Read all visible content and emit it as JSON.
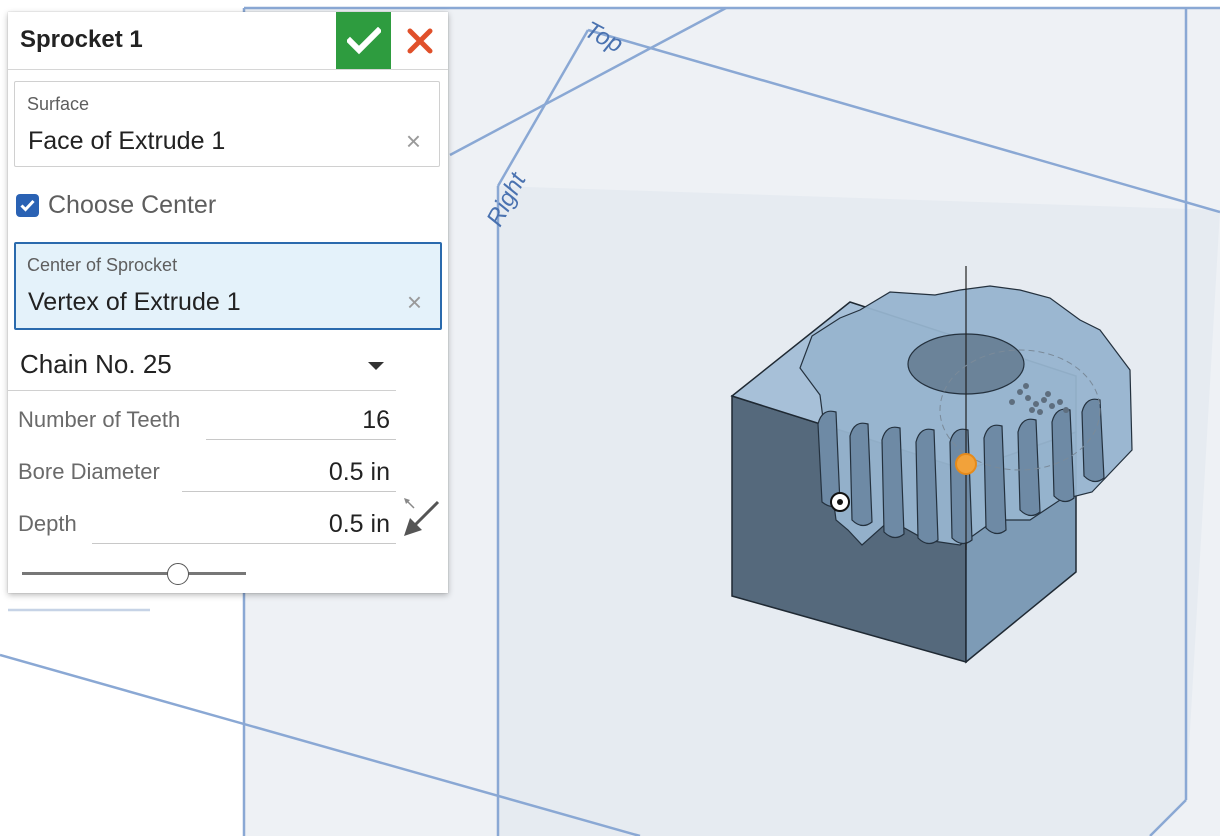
{
  "viewport": {
    "plane_top_label": "Top",
    "plane_right_label": "Right"
  },
  "panel": {
    "title": "Sprocket 1",
    "ok_icon": "checkmark-icon",
    "cancel_icon": "close-x-icon",
    "surface": {
      "label": "Surface",
      "value": "Face of Extrude 1"
    },
    "choose_center": {
      "label": "Choose Center",
      "checked": true
    },
    "center": {
      "label": "Center of Sprocket",
      "value": "Vertex of Extrude 1"
    },
    "chain": {
      "value": "Chain No. 25"
    },
    "teeth": {
      "label": "Number of Teeth",
      "value": "16"
    },
    "bore": {
      "label": "Bore Diameter",
      "value": "0.5 in"
    },
    "depth": {
      "label": "Depth",
      "value": "0.5 in"
    },
    "slider": {
      "fraction": 0.69
    }
  },
  "colors": {
    "ok_green": "#2e9c3f",
    "cancel_red": "#e0502a",
    "accent_blue": "#2a6aad",
    "active_field_bg": "#e4f2fa",
    "plane_line": "#8aa8d4"
  }
}
